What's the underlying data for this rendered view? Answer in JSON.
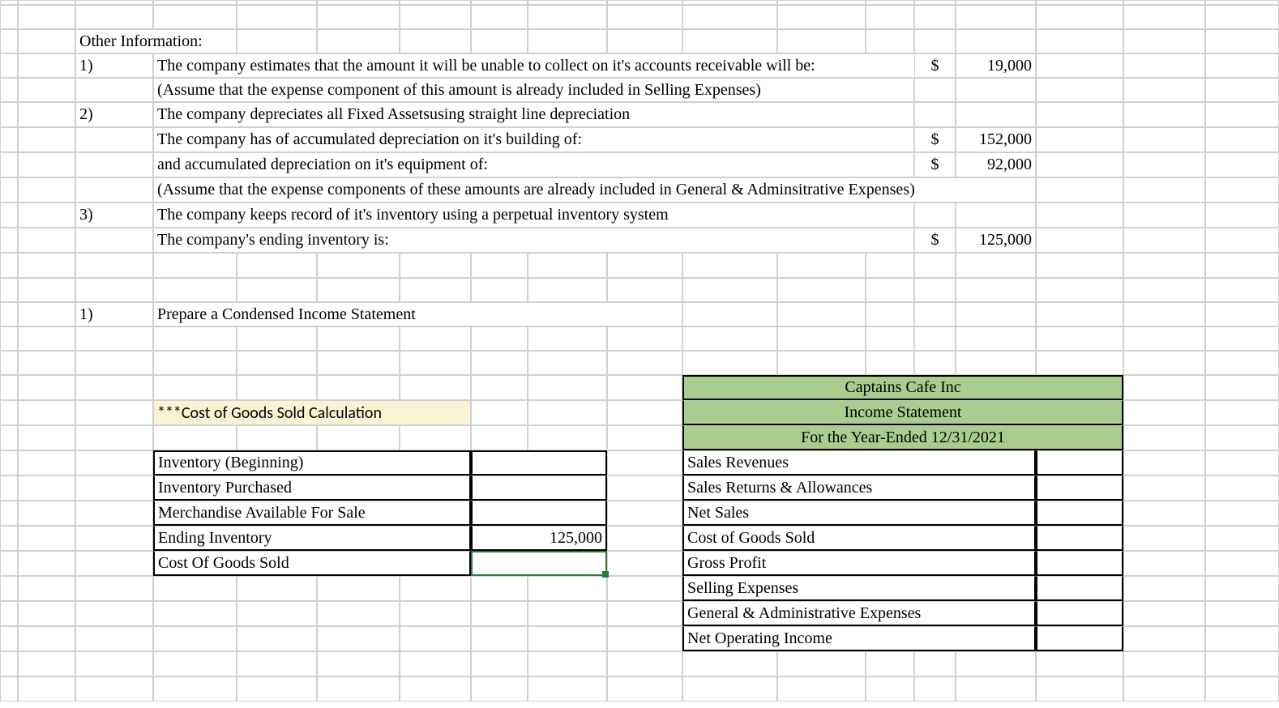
{
  "info": {
    "heading": "Other Information:",
    "n1": "1)",
    "n2": "2)",
    "n3": "3)",
    "line1": "The company estimates that the amount it will be unable to collect on it's accounts receivable will be:",
    "line1b": "(Assume that the expense component of this amount is already included in Selling Expenses)",
    "line2": "The company depreciates all Fixed Assetsusing straight line depreciation",
    "line2b": "The company has of accumulated depreciation on it's building of:",
    "line2c": "and accumulated depreciation on it's equipment of:",
    "line2d": "(Assume that the expense components of these amounts are already included in General & Adminsitrative Expenses)",
    "line3": "The company keeps record of it's inventory using a perpetual inventory system",
    "line3b": "The company's ending inventory is:",
    "task_n": "1)",
    "task": "Prepare a Condensed Income Statement",
    "dollar": "$",
    "v19000": "19,000",
    "v152000": "152,000",
    "v92000": "92,000",
    "v125000": "125,000"
  },
  "cogs": {
    "title": "***Cost of Goods Sold Calculation",
    "r1": "Inventory (Beginning)",
    "r2": "Inventory Purchased",
    "r3": "Merchandise Available For Sale",
    "r4": "Ending Inventory",
    "r5": "Cost Of Goods Sold",
    "ending_val": "125,000"
  },
  "stmt": {
    "h1": "Captains Cafe Inc",
    "h2": "Income Statement",
    "h3": "For the Year-Ended 12/31/2021",
    "r1": "Sales Revenues",
    "r2": "Sales Returns & Allowances",
    "r3": "Net Sales",
    "r4": "Cost of Goods Sold",
    "r5": "Gross Profit",
    "r6": "Selling Expenses",
    "r7": "General & Administrative Expenses",
    "r8": "Net Operating Income"
  },
  "chart_data": {
    "type": "table",
    "other_information": [
      {
        "item": "Estimated uncollectible accounts receivable",
        "value": 19000
      },
      {
        "item": "Accumulated depreciation - building",
        "value": 152000
      },
      {
        "item": "Accumulated depreciation - equipment",
        "value": 92000
      },
      {
        "item": "Ending inventory",
        "value": 125000
      }
    ],
    "cogs_calculation": {
      "Inventory (Beginning)": null,
      "Inventory Purchased": null,
      "Merchandise Available For Sale": null,
      "Ending Inventory": 125000,
      "Cost Of Goods Sold": null
    },
    "income_statement": {
      "title": "Captains Cafe Inc",
      "subtitle": "Income Statement",
      "period": "For the Year-Ended 12/31/2021",
      "lines": [
        "Sales Revenues",
        "Sales Returns & Allowances",
        "Net Sales",
        "Cost of Goods Sold",
        "Gross Profit",
        "Selling Expenses",
        "General & Administrative Expenses",
        "Net Operating Income"
      ]
    }
  }
}
